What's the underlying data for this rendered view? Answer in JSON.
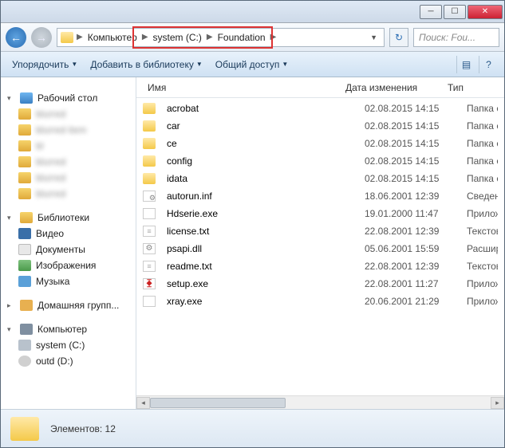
{
  "breadcrumb": {
    "computer": "Компьютер",
    "drive": "system (C:)",
    "folder": "Foundation"
  },
  "search": {
    "placeholder": "Поиск: Fou..."
  },
  "toolbar": {
    "organize": "Упорядочить",
    "addlib": "Добавить в библиотеку",
    "share": "Общий доступ"
  },
  "sidebar": {
    "desktop": "Рабочий стол",
    "libs": "Библиотеки",
    "video": "Видео",
    "docs": "Документы",
    "images": "Изображения",
    "music": "Музыка",
    "homegroup": "Домашняя групп...",
    "computer": "Компьютер",
    "drive_c": "system (C:)",
    "drive_d": "outd (D:)"
  },
  "columns": {
    "name": "Имя",
    "date": "Дата изменения",
    "type": "Тип"
  },
  "files": [
    {
      "icon": "folder",
      "name": "acrobat",
      "date": "02.08.2015 14:15",
      "type": "Папка с фа"
    },
    {
      "icon": "folder",
      "name": "car",
      "date": "02.08.2015 14:15",
      "type": "Папка с фа"
    },
    {
      "icon": "folder",
      "name": "ce",
      "date": "02.08.2015 14:15",
      "type": "Папка с фа"
    },
    {
      "icon": "folder",
      "name": "config",
      "date": "02.08.2015 14:15",
      "type": "Папка с фа"
    },
    {
      "icon": "folder",
      "name": "idata",
      "date": "02.08.2015 14:15",
      "type": "Папка с фа"
    },
    {
      "icon": "inf",
      "name": "autorun.inf",
      "date": "18.06.2001 12:39",
      "type": "Сведения д"
    },
    {
      "icon": "exe",
      "name": "Hdserie.exe",
      "date": "19.01.2000 11:47",
      "type": "Приложени"
    },
    {
      "icon": "txt",
      "name": "license.txt",
      "date": "22.08.2001 12:39",
      "type": "Текстовый"
    },
    {
      "icon": "dll",
      "name": "psapi.dll",
      "date": "05.06.2001 15:59",
      "type": "Расширен"
    },
    {
      "icon": "txt",
      "name": "readme.txt",
      "date": "22.08.2001 12:39",
      "type": "Текстовый"
    },
    {
      "icon": "setup",
      "name": "setup.exe",
      "date": "22.08.2001 11:27",
      "type": "Приложени"
    },
    {
      "icon": "exe",
      "name": "xray.exe",
      "date": "20.06.2001 21:29",
      "type": "Приложени"
    }
  ],
  "status": {
    "text": "Элементов: 12"
  }
}
